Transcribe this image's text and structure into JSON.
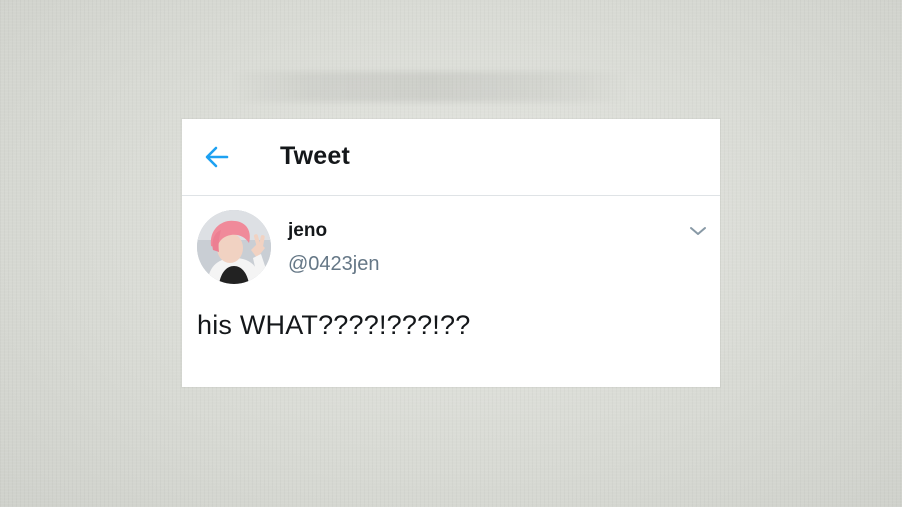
{
  "header": {
    "title": "Tweet",
    "back_icon": "arrow-left-icon"
  },
  "tweet": {
    "display_name": "jeno",
    "handle": "@0423jen",
    "text": "his WHAT????!???!??",
    "menu_icon": "chevron-down-icon",
    "avatar_icon": "profile-photo"
  },
  "colors": {
    "accent": "#1da1f2",
    "text_primary": "#14171a",
    "text_secondary": "#657786",
    "divider": "#dfe3e6",
    "card_background": "#ffffff",
    "page_background": "#d9dbd5"
  }
}
